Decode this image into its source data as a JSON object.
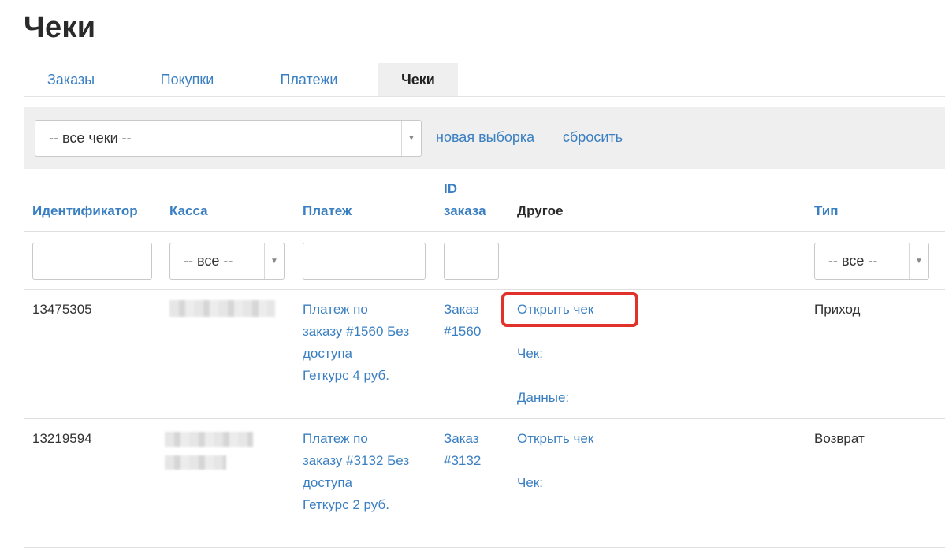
{
  "page": {
    "title": "Чеки"
  },
  "tabs": [
    {
      "label": "Заказы",
      "active": false
    },
    {
      "label": "Покупки",
      "active": false
    },
    {
      "label": "Платежи",
      "active": false
    },
    {
      "label": "Чеки",
      "active": true
    }
  ],
  "filter": {
    "select_value": "-- все чеки --",
    "new_selection_label": "новая выборка",
    "reset_label": "сбросить"
  },
  "table": {
    "columns": {
      "id": "Идентификатор",
      "kassa": "Касса",
      "payment": "Платеж",
      "order_id_line1": "ID",
      "order_id_line2": "заказа",
      "other": "Другое",
      "type": "Тип"
    },
    "filters": {
      "kassa_value": "-- все --",
      "type_value": "-- все --"
    },
    "rows": [
      {
        "id": "13475305",
        "payment_lines": [
          "Платеж по",
          "заказу #1560 Без",
          "доступа",
          "Геткурс 4 руб."
        ],
        "order_lines": [
          "Заказ",
          "#1560"
        ],
        "open_check": "Открыть чек",
        "check_label": "Чек:",
        "data_label": "Данные:",
        "type": "Приход"
      },
      {
        "id": "13219594",
        "payment_lines": [
          "Платеж по",
          "заказу #3132 Без",
          "доступа",
          "Геткурс 2 руб."
        ],
        "order_lines": [
          "Заказ",
          "#3132"
        ],
        "open_check": "Открыть чек",
        "check_label": "Чек:",
        "type": "Возврат"
      }
    ]
  },
  "colors": {
    "link": "#3a7fc1",
    "highlight": "#e0322b",
    "filter_bg": "#efefef"
  }
}
